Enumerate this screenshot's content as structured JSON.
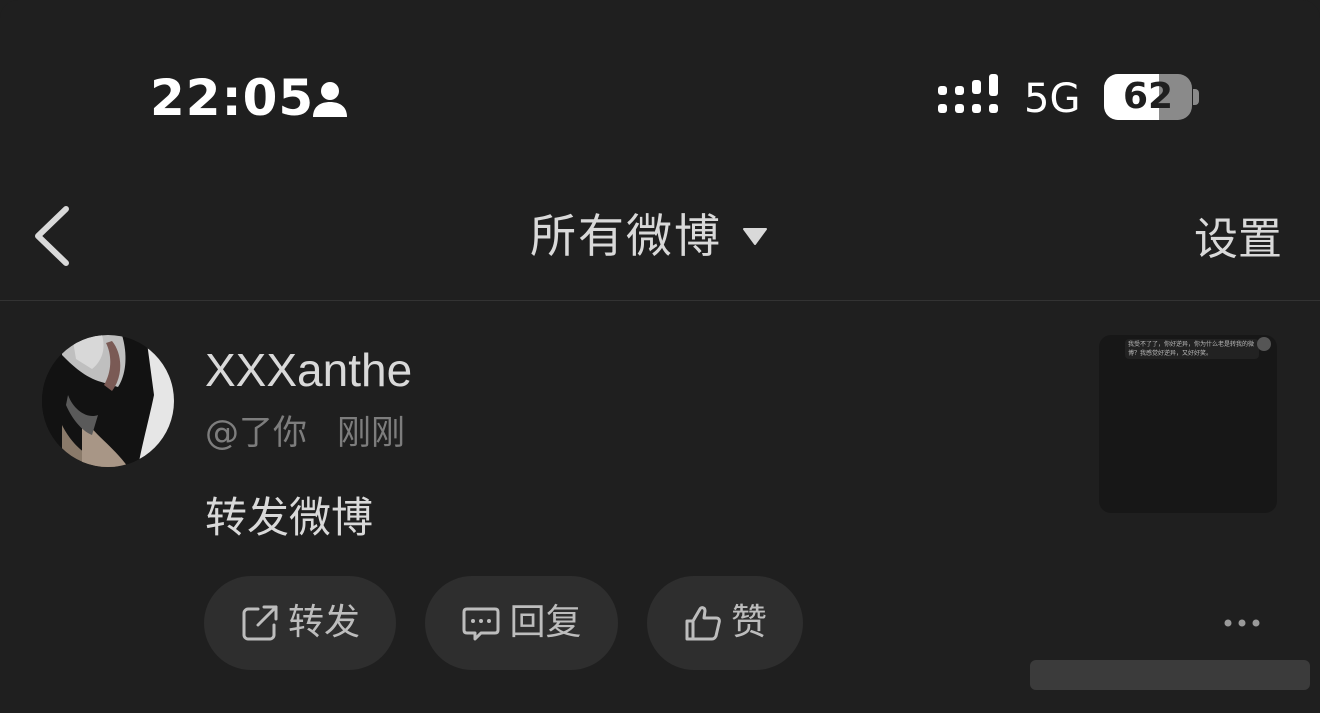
{
  "status_bar": {
    "time": "22:05",
    "network": "5G",
    "battery_level": "62",
    "icons": [
      "person-icon",
      "signal-icon",
      "battery-icon"
    ]
  },
  "nav": {
    "back_icon": "chevron-left-icon",
    "title": "所有微博",
    "title_icon": "caret-down-icon",
    "settings_label": "设置"
  },
  "post": {
    "username": "XXXanthe",
    "mention": "@了你",
    "time": "刚刚",
    "content": "转发微博",
    "thumbnail_caption": "我受不了了，你好逆异，你为什么老是转我的微博？我感觉好逆异，又好好笑。",
    "actions": [
      {
        "label": "转发",
        "icon": "share-icon"
      },
      {
        "label": "回复",
        "icon": "comment-icon"
      },
      {
        "label": "赞",
        "icon": "thumbs-up-icon"
      }
    ],
    "more_icon": "more-icon"
  },
  "colors": {
    "background": "#1f1f1f",
    "primary_text": "#d9d9d9",
    "secondary_text": "#7d7d7d",
    "button_bg": "#2e2e2e",
    "divider": "#333333"
  }
}
